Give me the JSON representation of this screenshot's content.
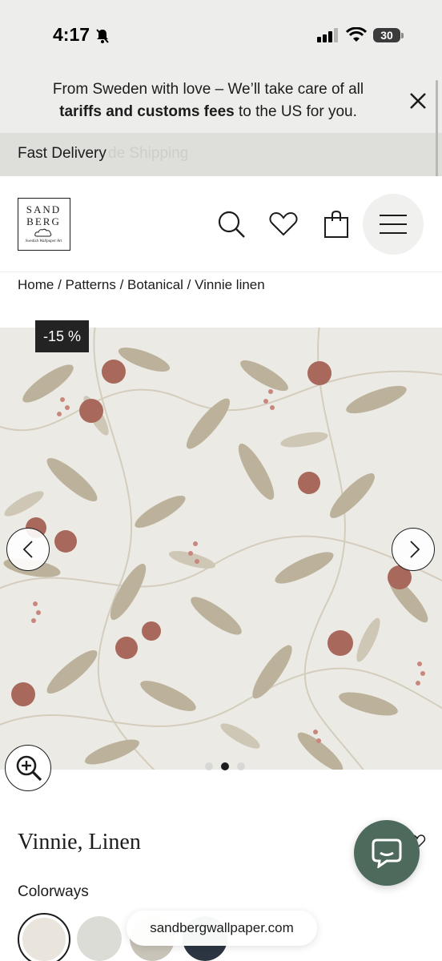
{
  "status_bar": {
    "time": "4:17",
    "battery": "30"
  },
  "announcement": {
    "line1": "From Sweden with love – We’ll take care of all",
    "line2_bold": "tariffs and customs fees",
    "line2_rest": " to the US for you."
  },
  "ticker": {
    "item1": "Fast Delivery",
    "item2": "de Shipping"
  },
  "logo": {
    "line1": "SAND",
    "line2": "BERG",
    "tagline": "Swedish Wallpaper Art"
  },
  "breadcrumb": {
    "items": [
      "Home",
      "Patterns",
      "Botanical",
      "Vinnie linen"
    ],
    "separator": " / "
  },
  "product": {
    "discount_badge": "-15 %",
    "title": "Vinnie, Linen",
    "gallery_active_index": 1,
    "gallery_count": 3
  },
  "colorways": {
    "label": "Colorways",
    "swatches": [
      "#e9e5dc",
      "#dcdcd6",
      "#c9c4b8",
      "#2c3642"
    ]
  },
  "browser": {
    "url": "sandbergwallpaper.com"
  },
  "colors": {
    "accent_chat": "#4e6a5c",
    "wallpaper_bg": "#eceae4",
    "leaf": "#bcb29c",
    "fruit": "#a8685c"
  }
}
